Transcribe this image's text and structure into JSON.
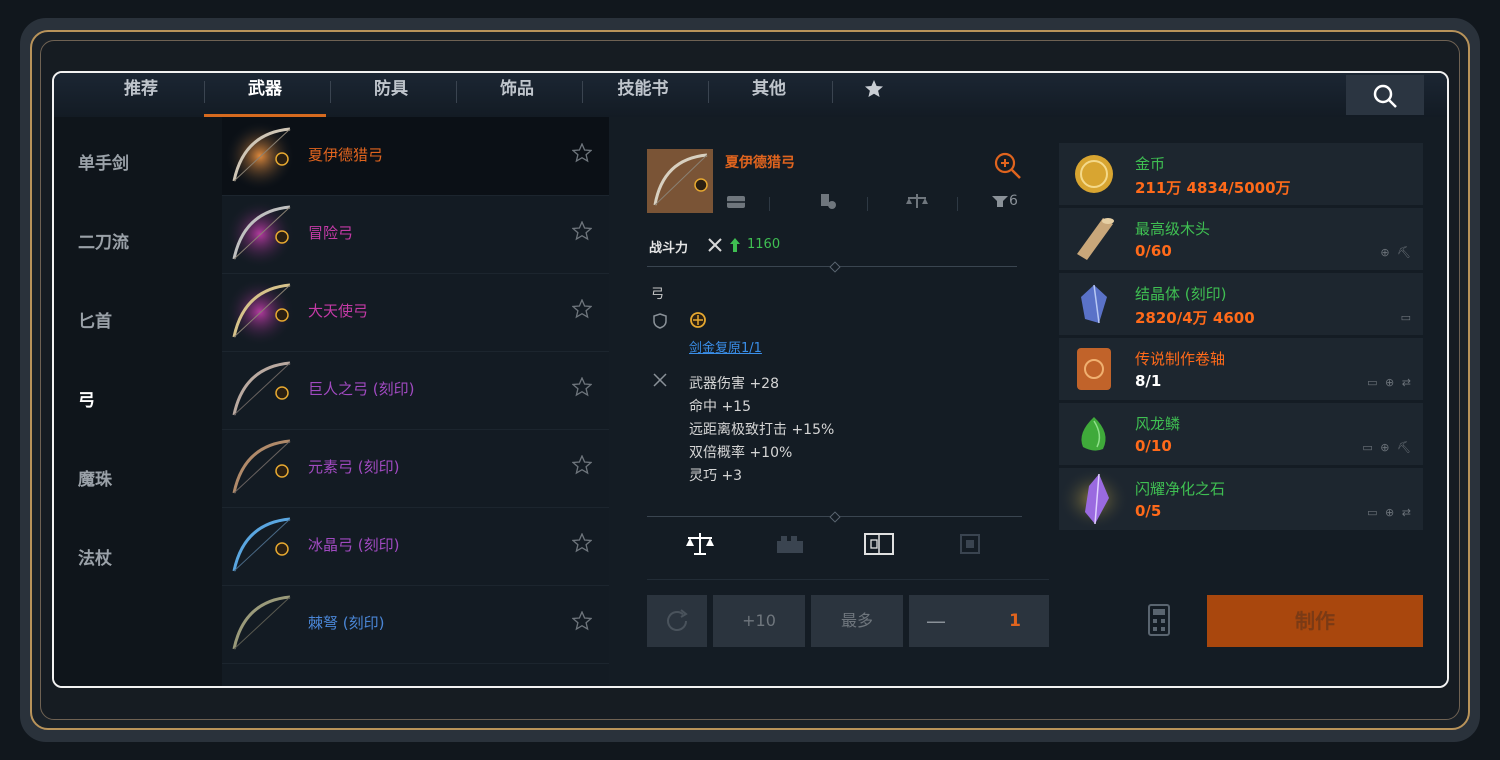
{
  "tabs": [
    "推荐",
    "武器",
    "防具",
    "饰品",
    "技能书",
    "其他"
  ],
  "categories": [
    "单手剑",
    "二刀流",
    "匕首",
    "弓",
    "魔珠",
    "法杖"
  ],
  "items": [
    {
      "name": "夏伊德猎弓",
      "color": "#e0641e"
    },
    {
      "name": "冒险弓",
      "color": "#c43aa6"
    },
    {
      "name": "大天使弓",
      "color": "#c43aa6"
    },
    {
      "name": "巨人之弓 (刻印)",
      "color": "#a04ac0"
    },
    {
      "name": "元素弓 (刻印)",
      "color": "#a04ac0"
    },
    {
      "name": "冰晶弓 (刻印)",
      "color": "#a04ac0"
    },
    {
      "name": "棘弩 (刻印)",
      "color": "#4a86d6"
    }
  ],
  "detail": {
    "name": "夏伊德猎弓",
    "attempts": "6",
    "power_label": "战斗力",
    "power_value": "1160",
    "type_label": "弓",
    "set_link": "剑金复原1/1",
    "stats": [
      "武器伤害 +28",
      "命中 +15",
      "远距离极致打击 +15%",
      "双倍概率 +10%",
      "灵巧 +3"
    ]
  },
  "materials": [
    {
      "name": "金币",
      "count": "211万 4834/5000万",
      "count_color": "orange",
      "icons": ""
    },
    {
      "name": "最高级木头",
      "count": "0/60",
      "count_color": "orange",
      "icons": "⊕ ⛏"
    },
    {
      "name": "结晶体 (刻印)",
      "count": "2820/4万 4600",
      "count_color": "orange",
      "icons": "▭"
    },
    {
      "name": "传说制作卷轴",
      "count": "8/1",
      "count_color": "white",
      "icons": "▭ ⊕ ⇄"
    },
    {
      "name": "风龙鳞",
      "count": "0/10",
      "count_color": "orange",
      "icons": "▭ ⊕ ⛏"
    },
    {
      "name": "闪耀净化之石",
      "count": "0/5",
      "count_color": "orange",
      "icons": "▭ ⊕ ⇄"
    }
  ],
  "controls": {
    "plus_ten": "+10",
    "max": "最多",
    "quantity": "1",
    "minus": "—",
    "plus": "+",
    "craft": "制作"
  },
  "colors": {
    "accent": "#d66a1f",
    "green": "#3fbf52",
    "orange": "#ff6a1a"
  }
}
